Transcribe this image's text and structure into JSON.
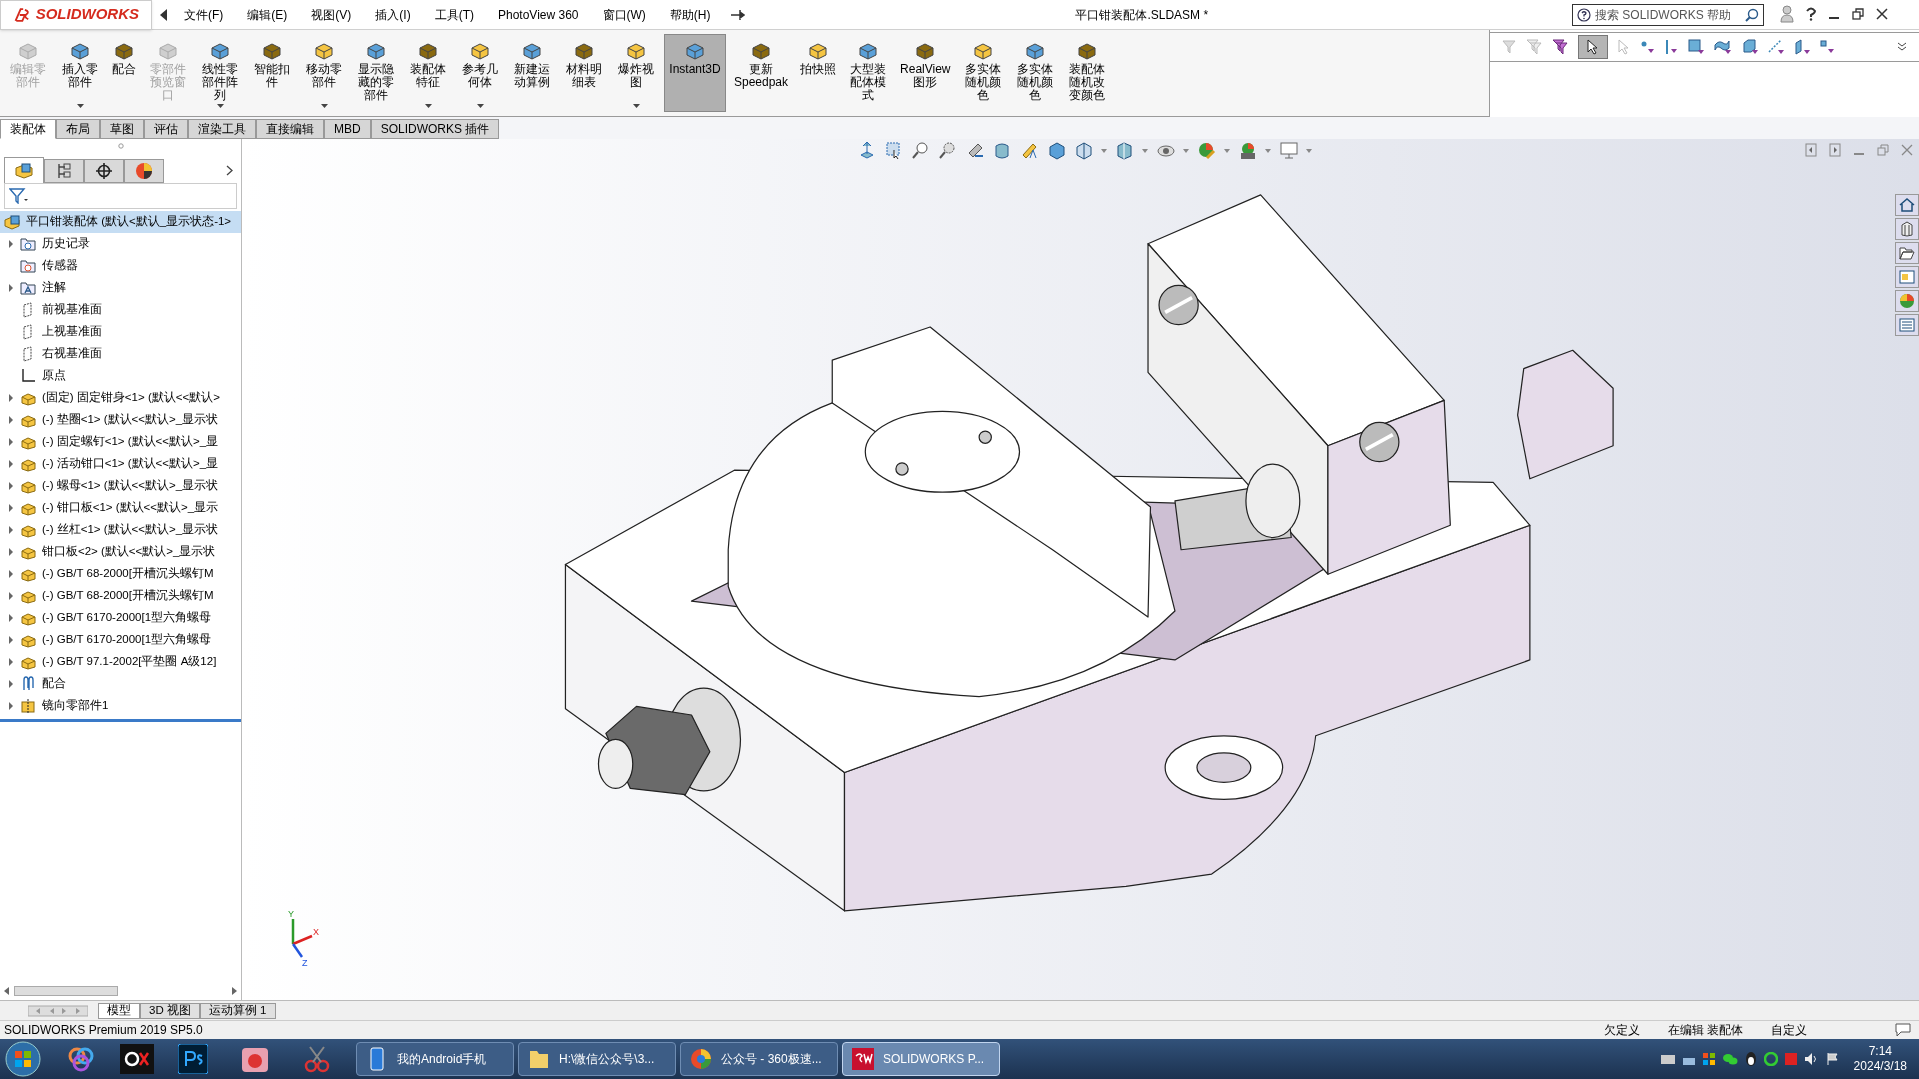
{
  "title_bar": {
    "logo": "SOLIDWORKS",
    "menu": [
      "文件(F)",
      "编辑(E)",
      "视图(V)",
      "插入(I)",
      "工具(T)",
      "PhotoView 360",
      "窗口(W)",
      "帮助(H)"
    ],
    "document_title": "平口钳装配体.SLDASM *",
    "search": {
      "placeholder": "搜索 SOLIDWORKS 帮助"
    }
  },
  "ribbon": [
    {
      "label": "编辑零部件",
      "disabled": true,
      "has_menu": false,
      "selected": false
    },
    {
      "label": "插入零部件",
      "disabled": false,
      "has_menu": true,
      "selected": false
    },
    {
      "label": "配合",
      "disabled": false,
      "has_menu": false,
      "selected": false
    },
    {
      "label": "零部件预览窗口",
      "disabled": true,
      "has_menu": false,
      "selected": false
    },
    {
      "label": "线性零部件阵列",
      "disabled": false,
      "has_menu": true,
      "selected": false
    },
    {
      "label": "智能扣件",
      "disabled": false,
      "has_menu": false,
      "selected": false
    },
    {
      "label": "移动零部件",
      "disabled": false,
      "has_menu": true,
      "selected": false
    },
    {
      "label": "显示隐藏的零部件",
      "disabled": false,
      "has_menu": false,
      "selected": false
    },
    {
      "label": "装配体特征",
      "disabled": false,
      "has_menu": true,
      "selected": false
    },
    {
      "label": "参考几何体",
      "disabled": false,
      "has_menu": true,
      "selected": false
    },
    {
      "label": "新建运动算例",
      "disabled": false,
      "has_menu": false,
      "selected": false
    },
    {
      "label": "材料明细表",
      "disabled": false,
      "has_menu": false,
      "selected": false
    },
    {
      "label": "爆炸视图",
      "disabled": false,
      "has_menu": true,
      "selected": false
    },
    {
      "label": "Instant3D",
      "disabled": false,
      "has_menu": false,
      "selected": true
    },
    {
      "label": "更新 Speedpak",
      "disabled": false,
      "has_menu": false,
      "selected": false
    },
    {
      "label": "拍快照",
      "disabled": false,
      "has_menu": false,
      "selected": false
    },
    {
      "label": "大型装配体模式",
      "disabled": false,
      "has_menu": false,
      "selected": false
    },
    {
      "label": "RealView 图形",
      "disabled": false,
      "has_menu": false,
      "selected": false
    },
    {
      "label": "多实体随机颜色",
      "disabled": false,
      "has_menu": false,
      "selected": false
    },
    {
      "label": "多实体随机颜色",
      "disabled": false,
      "has_menu": false,
      "selected": false
    },
    {
      "label": "装配体随机改变颜色",
      "disabled": false,
      "has_menu": false,
      "selected": false
    }
  ],
  "command_tabs": [
    {
      "label": "装配体",
      "selected": true
    },
    {
      "label": "布局",
      "selected": false
    },
    {
      "label": "草图",
      "selected": false
    },
    {
      "label": "评估",
      "selected": false
    },
    {
      "label": "渲染工具",
      "selected": false
    },
    {
      "label": "直接编辑",
      "selected": false
    },
    {
      "label": "MBD",
      "selected": false
    },
    {
      "label": "SOLIDWORKS 插件",
      "selected": false
    }
  ],
  "feature_tree": {
    "root": {
      "label": "平口钳装配体  (默认<默认_显示状态-1>",
      "selected": true
    },
    "items": [
      {
        "label": "历史记录",
        "kind": "history",
        "expanded": false
      },
      {
        "label": "传感器",
        "kind": "sensor"
      },
      {
        "label": "注解",
        "kind": "annotation",
        "expanded": false
      },
      {
        "label": "前视基准面",
        "kind": "plane"
      },
      {
        "label": "上视基准面",
        "kind": "plane"
      },
      {
        "label": "右视基准面",
        "kind": "plane"
      },
      {
        "label": "原点",
        "kind": "origin"
      },
      {
        "label": "(固定) 固定钳身<1> (默认<<默认>",
        "kind": "part",
        "expanded": false
      },
      {
        "label": "(-) 垫圈<1> (默认<<默认>_显示状",
        "kind": "part",
        "expanded": false
      },
      {
        "label": "(-) 固定螺钉<1> (默认<<默认>_显",
        "kind": "part",
        "expanded": false
      },
      {
        "label": "(-) 活动钳口<1> (默认<<默认>_显",
        "kind": "part",
        "expanded": false
      },
      {
        "label": "(-) 螺母<1> (默认<<默认>_显示状",
        "kind": "part",
        "expanded": false
      },
      {
        "label": "(-) 钳口板<1> (默认<<默认>_显示",
        "kind": "part",
        "expanded": false
      },
      {
        "label": "(-) 丝杠<1> (默认<<默认>_显示状",
        "kind": "part",
        "expanded": false
      },
      {
        "label": "钳口板<2> (默认<<默认>_显示状",
        "kind": "part",
        "expanded": false
      },
      {
        "label": "(-) GB/T 68-2000[开槽沉头螺钉M",
        "kind": "part",
        "expanded": false
      },
      {
        "label": "(-) GB/T 68-2000[开槽沉头螺钉M",
        "kind": "part",
        "expanded": false
      },
      {
        "label": "(-) GB/T 6170-2000[1型六角螺母",
        "kind": "part",
        "expanded": false
      },
      {
        "label": "(-) GB/T 6170-2000[1型六角螺母",
        "kind": "part",
        "expanded": false
      },
      {
        "label": "(-) GB/T 97.1-2002[平垫圈 A级12]",
        "kind": "part",
        "expanded": false
      },
      {
        "label": "配合",
        "kind": "mate",
        "expanded": false
      },
      {
        "label": "镜向零部件1",
        "kind": "mirror",
        "expanded": false
      }
    ]
  },
  "triad": [
    "Y",
    "X",
    "Z"
  ],
  "view_tabs": [
    {
      "label": "模型",
      "selected": true
    },
    {
      "label": "3D 视图",
      "selected": false
    },
    {
      "label": "运动算例 1",
      "selected": false
    }
  ],
  "status_bar": {
    "product": "SOLIDWORKS Premium 2019 SP5.0",
    "fields": [
      "欠定义",
      "在编辑 装配体",
      "自定义"
    ]
  },
  "taskbar": {
    "tasks": [
      {
        "label": "我的Android手机",
        "active": false
      },
      {
        "label": "H:\\微信公众号\\3...",
        "active": false
      },
      {
        "label": "公众号 - 360极速...",
        "active": false
      },
      {
        "label": "SOLIDWORKS P...",
        "active": true
      }
    ],
    "clock": {
      "time": "7:14",
      "date": "2024/3/18"
    }
  }
}
